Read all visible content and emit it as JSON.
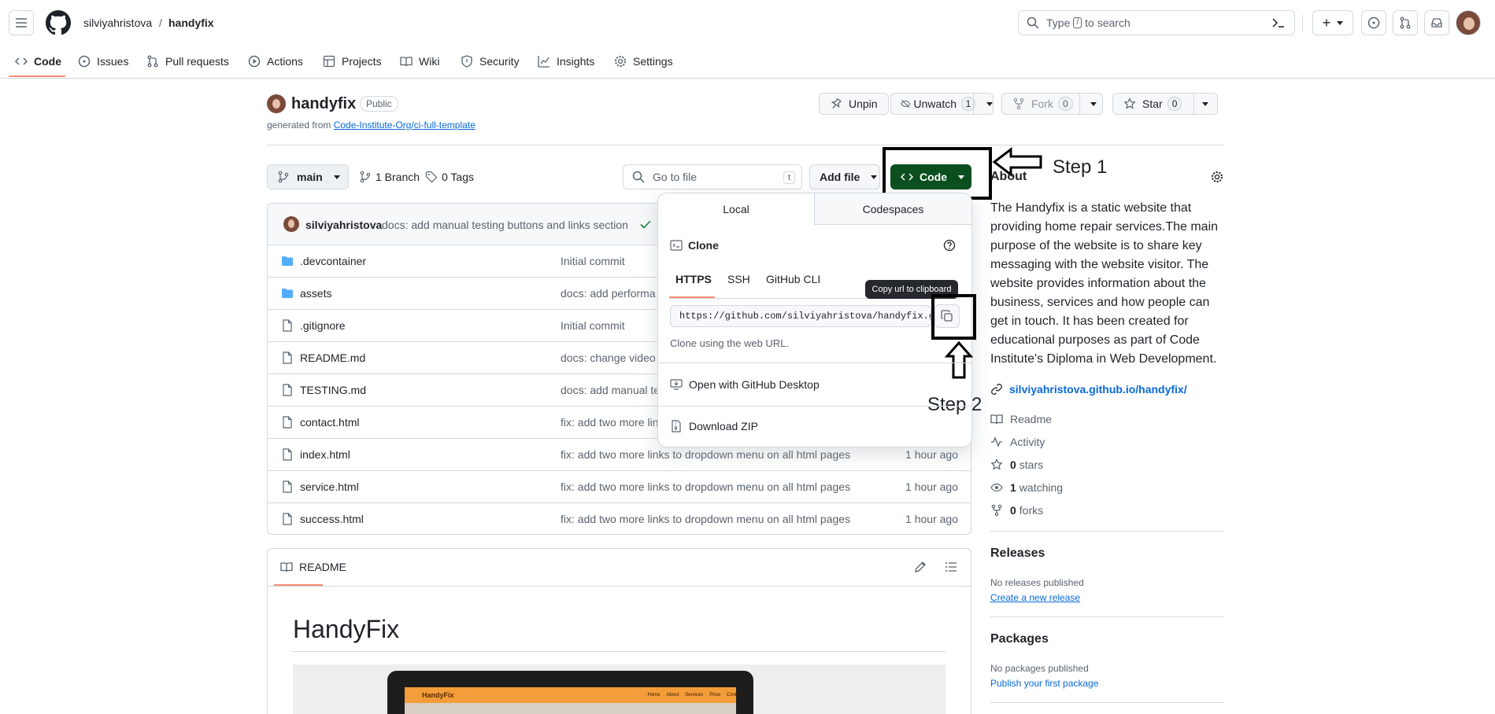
{
  "header": {
    "owner": "silviyahristova",
    "slash": "/",
    "repo": "handyfix",
    "search_placeholder_prefix": "Type",
    "search_key": "/",
    "search_placeholder_suffix": "to search",
    "plus": "+"
  },
  "nav": {
    "tabs": [
      {
        "label": "Code"
      },
      {
        "label": "Issues"
      },
      {
        "label": "Pull requests"
      },
      {
        "label": "Actions"
      },
      {
        "label": "Projects"
      },
      {
        "label": "Wiki"
      },
      {
        "label": "Security"
      },
      {
        "label": "Insights"
      },
      {
        "label": "Settings"
      }
    ]
  },
  "repo": {
    "name": "handyfix",
    "visibility": "Public",
    "generated_prefix": "generated from",
    "template_link": "Code-Institute-Org/ci-full-template",
    "unpin": "Unpin",
    "unwatch": "Unwatch",
    "watch_count": "1",
    "fork": "Fork",
    "fork_count": "0",
    "star": "Star",
    "star_count": "0"
  },
  "toolbar": {
    "branch": "main",
    "branches": "1 Branch",
    "tags": "0 Tags",
    "goto_placeholder": "Go to file",
    "goto_key": "t",
    "add_file": "Add file",
    "code": "Code"
  },
  "commit": {
    "author": "silviyahristova",
    "message": "docs: add manual testing buttons and links section"
  },
  "files": [
    {
      "name": ".devcontainer",
      "type": "folder",
      "message": "Initial commit",
      "time": ""
    },
    {
      "name": "assets",
      "type": "folder",
      "message": "docs: add performa",
      "time": ""
    },
    {
      "name": ".gitignore",
      "type": "file",
      "message": "Initial commit",
      "time": ""
    },
    {
      "name": "README.md",
      "type": "file",
      "message": "docs: change video",
      "time": ""
    },
    {
      "name": "TESTING.md",
      "type": "file",
      "message": "docs: add manual te",
      "time": ""
    },
    {
      "name": "contact.html",
      "type": "file",
      "message": "fix: add two more lin",
      "time": ""
    },
    {
      "name": "index.html",
      "type": "file",
      "message": "fix: add two more links to dropdown menu on all html pages",
      "time": "1 hour ago"
    },
    {
      "name": "service.html",
      "type": "file",
      "message": "fix: add two more links to dropdown menu on all html pages",
      "time": "1 hour ago"
    },
    {
      "name": "success.html",
      "type": "file",
      "message": "fix: add two more links to dropdown menu on all html pages",
      "time": "1 hour ago"
    }
  ],
  "clone_popup": {
    "tab_local": "Local",
    "tab_codespaces": "Codespaces",
    "clone_title": "Clone",
    "proto_https": "HTTPS",
    "proto_ssh": "SSH",
    "proto_cli": "GitHub CLI",
    "url": "https://github.com/silviyahristova/handyfix.git",
    "hint": "Clone using the web URL.",
    "open_desktop": "Open with GitHub Desktop",
    "download_zip": "Download ZIP",
    "tooltip": "Copy url to clipboard"
  },
  "annotations": {
    "step1": "Step 1",
    "step2": "Step 2"
  },
  "about": {
    "title": "About",
    "description": "The Handyfix is a static website that providing home repair services.The main purpose of the website is to share key messaging with the website visitor. The website provides information about the business, services and how people can get in touch. It has been created for educational purposes as part of Code Institute's Diploma in Web Development.",
    "website": "silviyahristova.github.io/handyfix/",
    "readme": "Readme",
    "activity": "Activity",
    "stars_count": "0",
    "stars_label": "stars",
    "watching_count": "1",
    "watching_label": "watching",
    "forks_count": "0",
    "forks_label": "forks"
  },
  "releases": {
    "title": "Releases",
    "none": "No releases published",
    "create": "Create a new release"
  },
  "packages": {
    "title": "Packages",
    "none": "No packages published",
    "publish": "Publish your first package"
  },
  "readme": {
    "tab": "README",
    "heading": "HandyFix",
    "preview_brand": "HandyFix",
    "preview_nav": [
      "Home",
      "About",
      "Services",
      "Price",
      "Contacts"
    ]
  },
  "colors": {
    "primary_green": "#1f6f2f",
    "code_green_dark": "#0b4f1f",
    "accent_orange": "#fd8c73",
    "link_blue": "#0969da",
    "folder_blue": "#54aeff"
  }
}
